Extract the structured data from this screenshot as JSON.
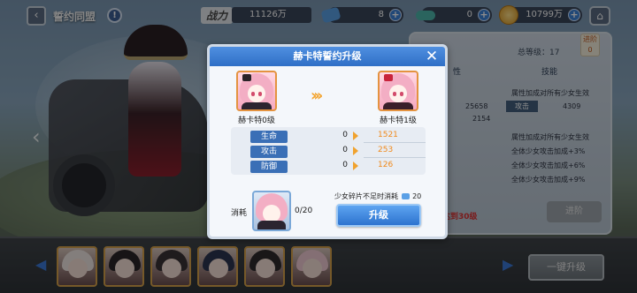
{
  "topbar": {
    "title": "誓约同盟",
    "info_icon": "info-icon",
    "power_label": "战力",
    "power_value": "11126万",
    "resources": [
      {
        "icon": "ticket-icon",
        "value": "8",
        "color": "#5aa0e6"
      },
      {
        "icon": "capsule-icon",
        "value": "0",
        "color": "#4db6ac"
      },
      {
        "icon": "gold-coin-icon",
        "value": "10799万",
        "color": "#e0a630"
      }
    ],
    "home_icon": "home-icon"
  },
  "right_panel": {
    "level_text": "总等级：17",
    "tab_left": "性",
    "tab_right": "技能",
    "attr_header_1": "属性加成对所有少女生效",
    "attr_header_2": "属性加成对所有少女生效",
    "val_1": "25658",
    "val_2": "2154",
    "attack_tag": "攻击",
    "attack_val": "4309",
    "bonus_1": "全体少女攻击加成+3%",
    "bonus_2": "全体少女攻击加成+6%",
    "bonus_3": "全体少女攻击加成+9%",
    "level_note": "达到30级",
    "advance_label": "进阶",
    "badge_text": "进阶"
  },
  "bottombar": {
    "chips": [
      {
        "name": "",
        "hair": "#efe6e2"
      },
      {
        "name": "",
        "hair": "#2b2628"
      },
      {
        "name": "",
        "hair": "#3a3235"
      },
      {
        "name": "",
        "hair": "#2d3550"
      },
      {
        "name": "",
        "hair": "#2e2a2c"
      },
      {
        "name": "",
        "hair": "#f1cbd3"
      }
    ],
    "one_key_label": "一键升级"
  },
  "dialog": {
    "title": "赫卡特誓约升级",
    "from_name": "赫卡特0级",
    "to_name": "赫卡特1级",
    "stats": [
      {
        "label": "生命",
        "from": "0",
        "to": "1521"
      },
      {
        "label": "攻击",
        "from": "0",
        "to": "253"
      },
      {
        "label": "防御",
        "from": "0",
        "to": "126"
      }
    ],
    "cost_label": "消耗",
    "cost_count": "0/20",
    "note": "少女碎片不足时消耗",
    "note_cost": "20",
    "upgrade_label": "升级"
  }
}
